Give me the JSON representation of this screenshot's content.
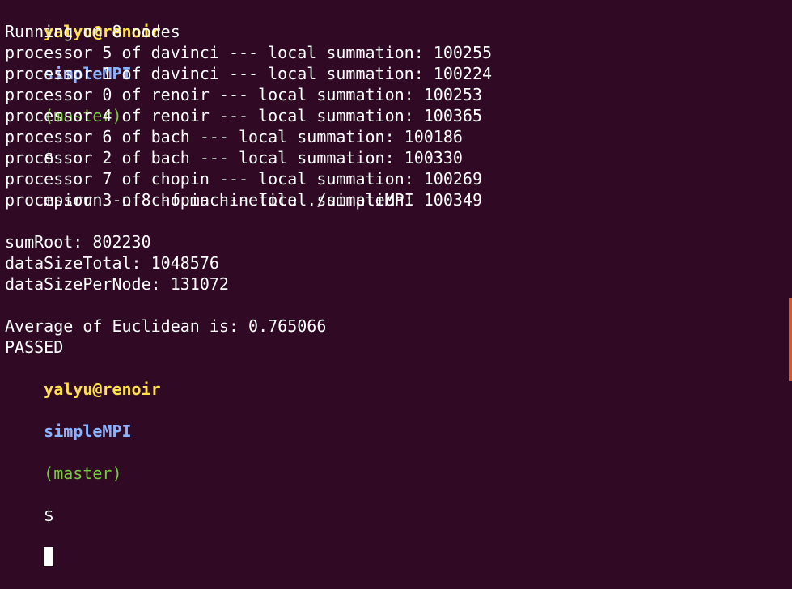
{
  "prompt": {
    "user": "yalyu@renoir",
    "dir": "simpleMPI",
    "branch": "(master)",
    "symbol": "$"
  },
  "command": "mpirun -n 8 -f machinefile ./simpleMPI",
  "output": {
    "running": "Running on 8 nodes",
    "procs": [
      "processor 5 of davinci --- local summation: 100255",
      "processor 1 of davinci --- local summation: 100224",
      "processor 0 of renoir --- local summation: 100253",
      "processor 4 of renoir --- local summation: 100365",
      "processor 6 of bach --- local summation: 100186",
      "processor 2 of bach --- local summation: 100330",
      "processor 7 of chopin --- local summation: 100269",
      "processor 3 of chopin --- local summation: 100349"
    ],
    "sum_root": "sumRoot: 802230",
    "data_size_total": "dataSizeTotal: 1048576",
    "data_size_per_node": "dataSizePerNode: 131072",
    "average": "Average of Euclidean is: 0.765066",
    "status": "PASSED"
  }
}
